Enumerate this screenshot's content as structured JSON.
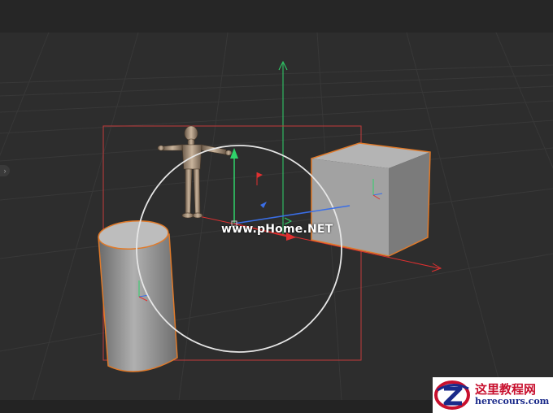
{
  "viewport": {
    "watermark_text": "www.pHome.NET",
    "side_toggle_label": "›",
    "colors": {
      "background": "#2d2d2d",
      "grid": "#3a3a3a",
      "selection_box": "#c23b3b",
      "rotate_circle": "#e6e6e6",
      "axis_x": "#e03030",
      "axis_y": "#2fd36a",
      "axis_z": "#3a6ee6",
      "object_outline": "#e07a2a",
      "object_gray": "#8a8a8a"
    },
    "objects": [
      "figure-mannequin",
      "cube",
      "cylinder"
    ]
  },
  "logo": {
    "chinese": "这里教程网",
    "url": "herecours.com"
  }
}
